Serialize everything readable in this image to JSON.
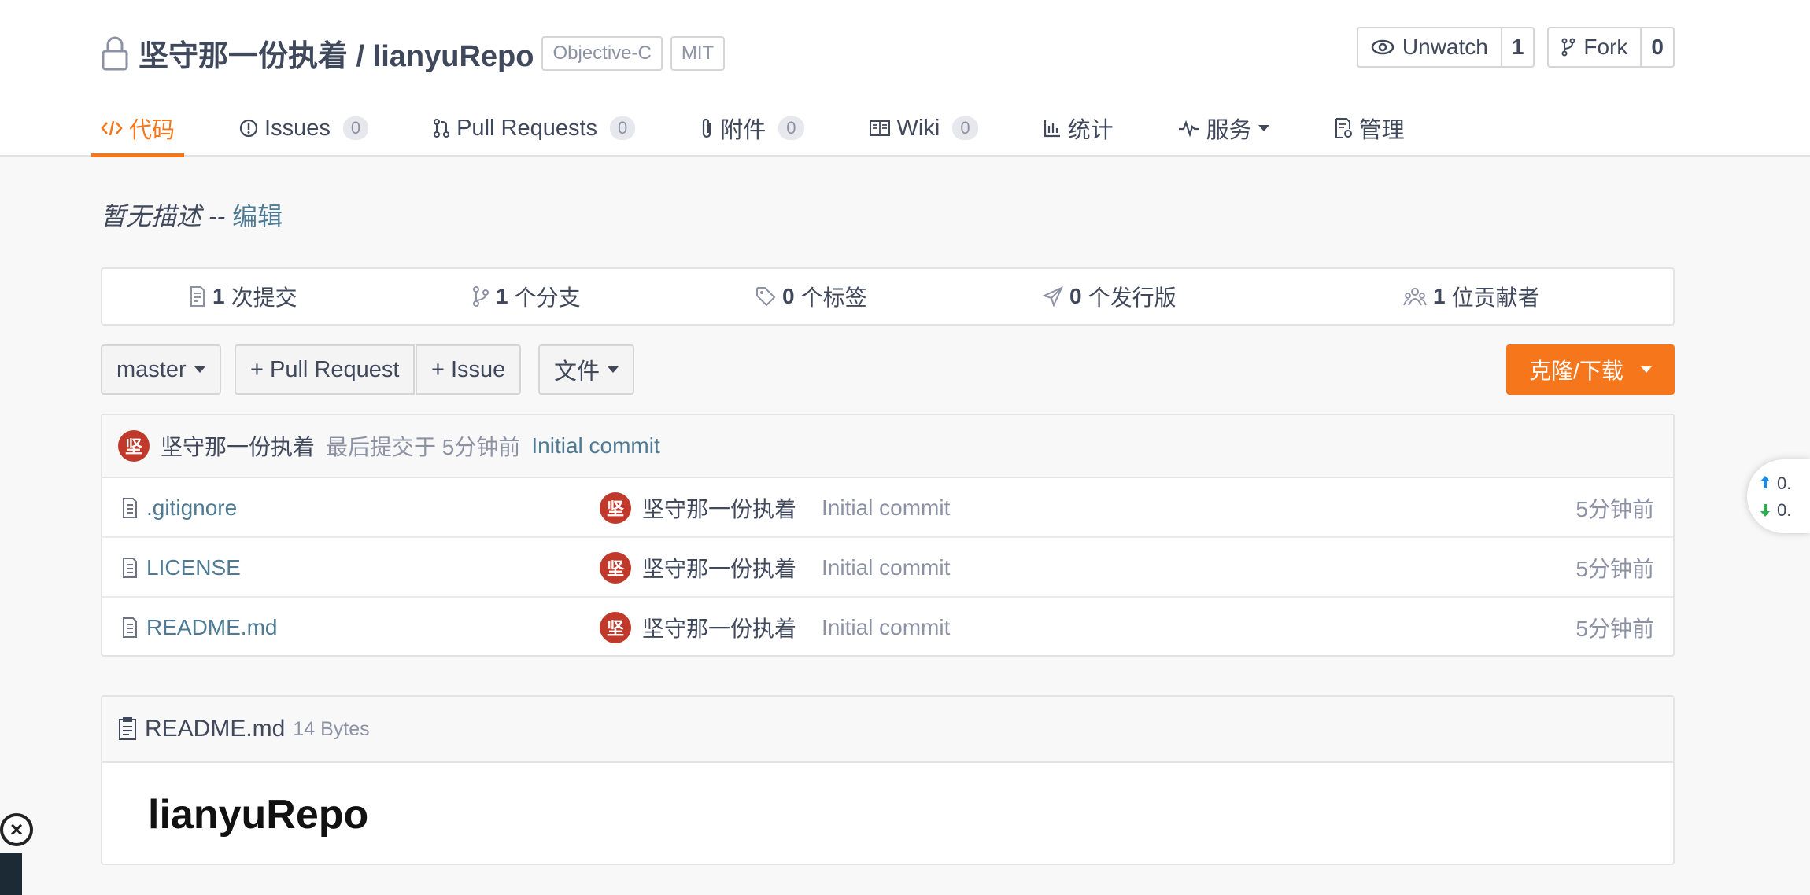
{
  "repo": {
    "title": "坚守那一份执着 / lianyuRepo",
    "language_tag": "Objective-C",
    "license_tag": "MIT"
  },
  "actions": {
    "watch_label": "Unwatch",
    "watch_count": "1",
    "fork_label": "Fork",
    "fork_count": "0"
  },
  "tabs": [
    {
      "label": "代码",
      "icon": "code-icon",
      "active": true
    },
    {
      "label": "Issues",
      "count": "0",
      "icon": "issue-icon"
    },
    {
      "label": "Pull Requests",
      "count": "0",
      "icon": "pull-request-icon"
    },
    {
      "label": "附件",
      "count": "0",
      "icon": "attachment-icon"
    },
    {
      "label": "Wiki",
      "count": "0",
      "icon": "book-icon"
    },
    {
      "label": "统计",
      "icon": "bar-chart-icon"
    },
    {
      "label": "服务",
      "icon": "pulse-icon"
    },
    {
      "label": "管理",
      "icon": "settings-doc-icon"
    }
  ],
  "description": {
    "text": "暂无描述 --",
    "edit_link": "编辑"
  },
  "stats": [
    {
      "count": "1",
      "label": "次提交",
      "icon": "commit-icon"
    },
    {
      "count": "1",
      "label": "个分支",
      "icon": "branch-icon"
    },
    {
      "count": "0",
      "label": "个标签",
      "icon": "tag-icon"
    },
    {
      "count": "0",
      "label": "个发行版",
      "icon": "release-icon"
    },
    {
      "count": "1",
      "label": "位贡献者",
      "icon": "contributors-icon"
    }
  ],
  "toolbar": {
    "branch": "master",
    "pull_request": "+ Pull Request",
    "issue": "+ Issue",
    "file": "文件",
    "clone": "克隆/下载"
  },
  "last_commit": {
    "avatar_char": "坚",
    "author": "坚守那一份执着",
    "prefix": "最后提交于 5分钟前",
    "message": "Initial commit"
  },
  "files": [
    {
      "name": ".gitignore",
      "author": "坚守那一份执着",
      "message": "Initial commit",
      "time": "5分钟前"
    },
    {
      "name": "LICENSE",
      "author": "坚守那一份执着",
      "message": "Initial commit",
      "time": "5分钟前"
    },
    {
      "name": "README.md",
      "author": "坚守那一份执着",
      "message": "Initial commit",
      "time": "5分钟前"
    }
  ],
  "readme": {
    "filename": "README.md",
    "size": "14 Bytes",
    "heading": "lianyuRepo"
  },
  "speed_widget": {
    "up": "0.",
    "down": "0."
  },
  "colors": {
    "accent": "#f6761b",
    "link": "#4e7a94",
    "avatar": "#c0392b"
  }
}
